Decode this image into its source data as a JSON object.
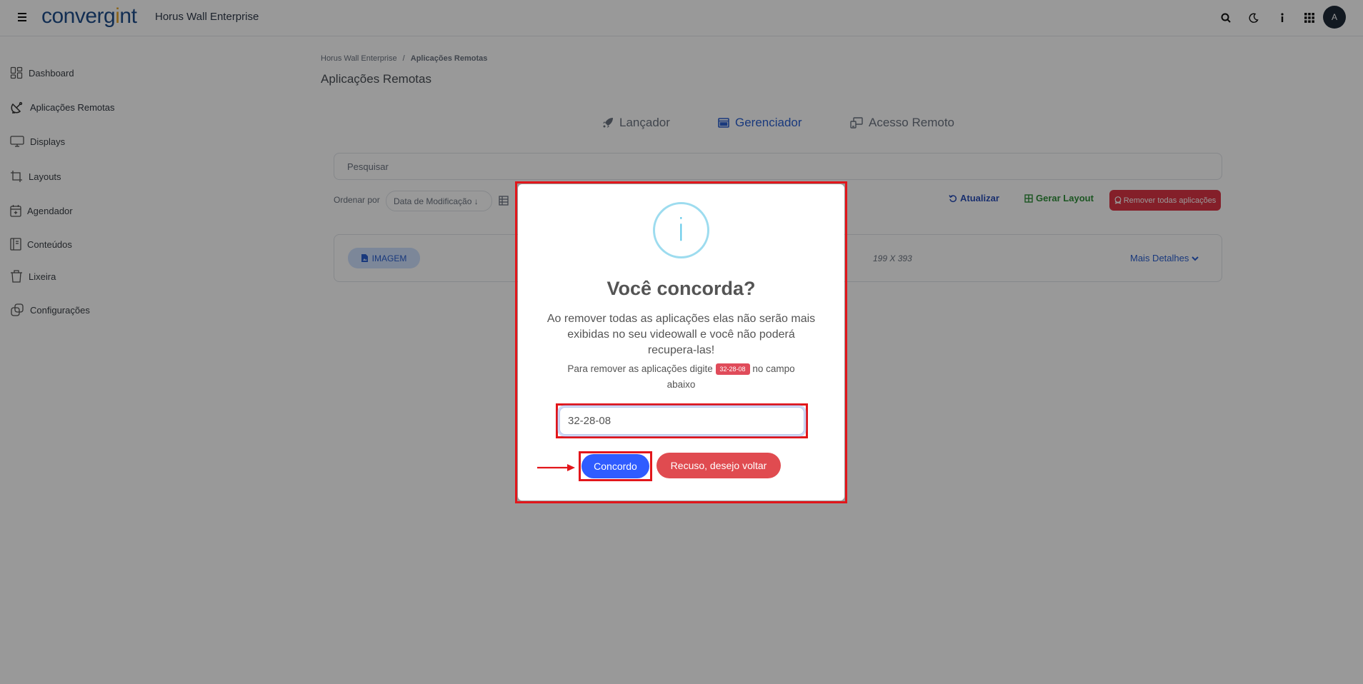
{
  "header": {
    "logo_text": "convergint",
    "app_name": "Horus Wall Enterprise",
    "icons": [
      "search-icon",
      "moon-icon",
      "info-icon",
      "apps-grid-icon"
    ],
    "avatar_initial": "A"
  },
  "sidebar": {
    "items": [
      {
        "label": "Dashboard",
        "icon": "dashboard-icon"
      },
      {
        "label": "Aplicações Remotas",
        "icon": "satellite-dish-icon"
      },
      {
        "label": "Displays",
        "icon": "monitor-icon"
      },
      {
        "label": "Layouts",
        "icon": "crop-icon"
      },
      {
        "label": "Agendador",
        "icon": "calendar-icon"
      },
      {
        "label": "Conteúdos",
        "icon": "content-icon"
      },
      {
        "label": "Lixeira",
        "icon": "trash-icon"
      },
      {
        "label": "Configurações",
        "icon": "settings-icon"
      }
    ]
  },
  "breadcrumb": {
    "root": "Horus Wall Enterprise",
    "separator": "/",
    "current": "Aplicações Remotas"
  },
  "page": {
    "title": "Aplicações Remotas"
  },
  "tabs": [
    {
      "label": "Lançador",
      "icon": "rocket-icon"
    },
    {
      "label": "Gerenciador",
      "icon": "window-icon",
      "active": true
    },
    {
      "label": "Acesso Remoto",
      "icon": "remote-desktop-icon"
    }
  ],
  "search": {
    "placeholder": "Pesquisar"
  },
  "toolbar": {
    "order_label": "Ordenar por",
    "order_value": "Data de Modificação ↓",
    "refresh_label": "Atualizar",
    "generate_layout_label": "Gerar Layout",
    "remove_all_label": "Remover todas aplicações"
  },
  "card": {
    "type_label": "IMAGEM",
    "dimensions": "199 X 393",
    "more_details_label": "Mais Detalhes"
  },
  "modal": {
    "icon_glyph": "i",
    "title": "Você concorda?",
    "message": "Ao remover todas as aplicações elas não serão mais exibidas no seu videowall e você não poderá recupera-las!",
    "instruction_before": "Para remover as aplicações digite",
    "code": "32-28-08",
    "instruction_after": "no campo abaixo",
    "input_value": "32-28-08",
    "confirm_label": "Concordo",
    "cancel_label": "Recuso, desejo voltar"
  },
  "colors": {
    "primary": "#2f5cff",
    "danger": "#e04b50",
    "annotation_red": "#e2161b",
    "info_blue": "#5bc6e8",
    "brand": "#1f4d8a"
  }
}
